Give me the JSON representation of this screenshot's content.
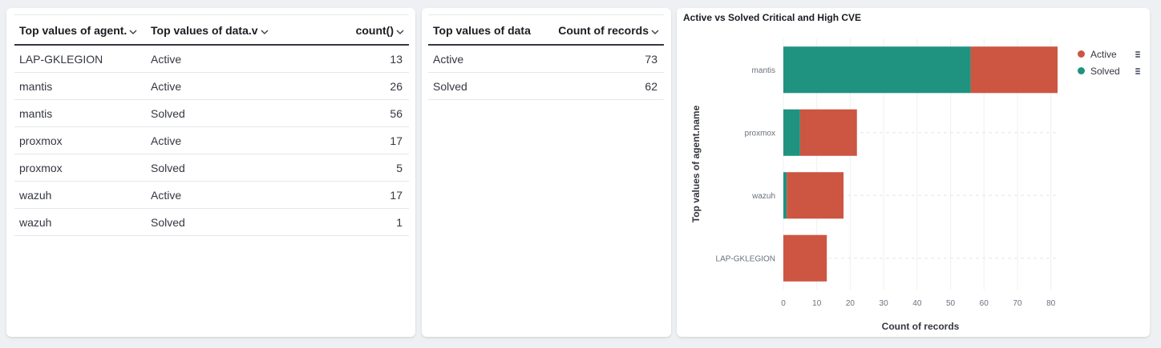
{
  "table1": {
    "headers": [
      "Top values of agent.",
      "Top values of data.v",
      "count()"
    ],
    "rows": [
      [
        "LAP-GKLEGION",
        "Active",
        "13"
      ],
      [
        "mantis",
        "Active",
        "26"
      ],
      [
        "mantis",
        "Solved",
        "56"
      ],
      [
        "proxmox",
        "Active",
        "17"
      ],
      [
        "proxmox",
        "Solved",
        "5"
      ],
      [
        "wazuh",
        "Active",
        "17"
      ],
      [
        "wazuh",
        "Solved",
        "1"
      ]
    ]
  },
  "table2": {
    "headers": [
      "Top values of data",
      "Count of records"
    ],
    "rows": [
      [
        "Active",
        "73"
      ],
      [
        "Solved",
        "62"
      ]
    ]
  },
  "chart": {
    "title": "Active vs Solved Critical and High CVE"
  },
  "chart_data": {
    "type": "bar",
    "orientation": "horizontal",
    "stacked": true,
    "title": "Active vs Solved Critical and High CVE",
    "xlabel": "Count of records",
    "ylabel": "Top values of agent.name",
    "categories": [
      "mantis",
      "proxmox",
      "wazuh",
      "LAP-GKLEGION"
    ],
    "series": [
      {
        "name": "Solved",
        "color": "#209280",
        "values": [
          56,
          5,
          1,
          0
        ]
      },
      {
        "name": "Active",
        "color": "#cc5642",
        "values": [
          26,
          17,
          17,
          13
        ]
      }
    ],
    "xticks": [
      0,
      10,
      20,
      30,
      40,
      50,
      60,
      70,
      80
    ],
    "xlim": [
      0,
      82
    ],
    "legend": "top-right",
    "grid": "dashed"
  },
  "legend": [
    {
      "label": "Active",
      "color": "#cc5642"
    },
    {
      "label": "Solved",
      "color": "#209280"
    }
  ]
}
